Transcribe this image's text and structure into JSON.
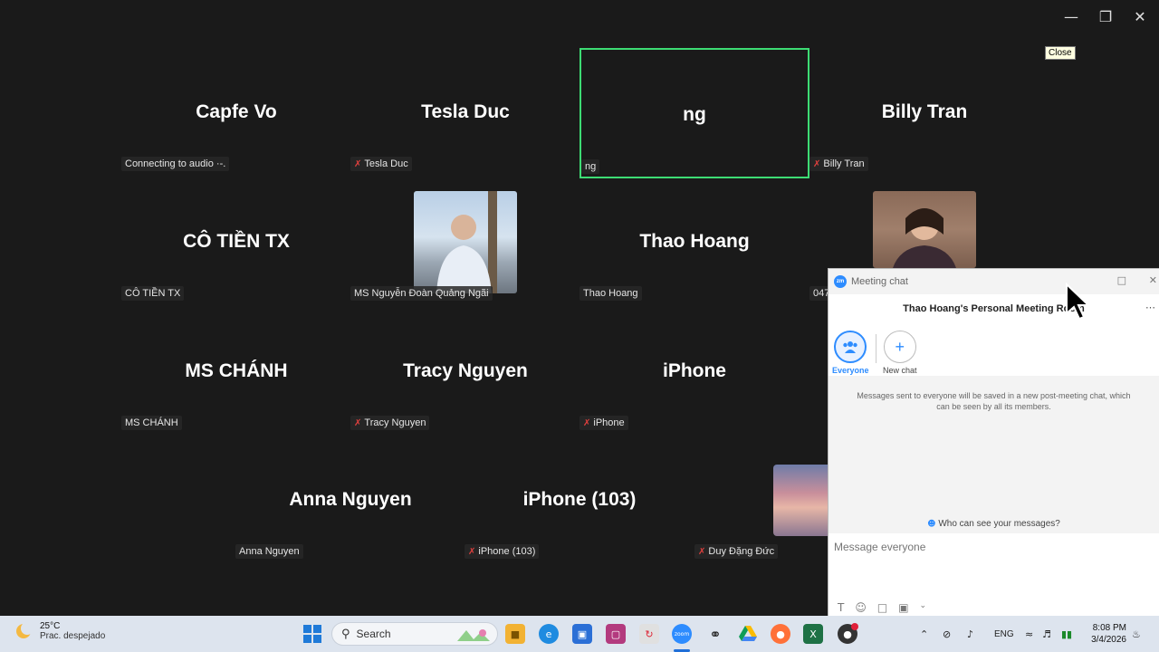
{
  "tooltip": "Close",
  "tiles": [
    {
      "name": "Capfe Vo",
      "label": "Connecting to audio ·-.",
      "muted": false
    },
    {
      "name": "Tesla Duc",
      "label": "Tesla Duc",
      "muted": true
    },
    {
      "name": "ng",
      "label": "ng",
      "muted": false
    },
    {
      "name": "Billy Tran",
      "label": "Billy Tran",
      "muted": true
    },
    {
      "name": "CÔ TIỀN TX",
      "label": "CÔ TIỀN TX",
      "muted": false
    },
    {
      "name": "",
      "label": "MS Nguyễn Đoàn Quảng Ngãi",
      "muted": false
    },
    {
      "name": "Thao Hoang",
      "label": "Thao Hoang",
      "muted": false
    },
    {
      "name": "",
      "label": "047",
      "muted": false
    },
    {
      "name": "MS CHÁNH",
      "label": "MS CHÁNH",
      "muted": false
    },
    {
      "name": "Tracy Nguyen",
      "label": "Tracy Nguyen",
      "muted": true
    },
    {
      "name": "iPhone",
      "label": "iPhone",
      "muted": true
    },
    {
      "name": "Anna Nguyen",
      "label": "Anna Nguyen",
      "muted": false
    },
    {
      "name": "iPhone (103)",
      "label": "iPhone (103)",
      "muted": true
    },
    {
      "name": "",
      "label": "Duy Đặng Đức",
      "muted": true
    }
  ],
  "chat": {
    "window_title": "Meeting chat",
    "logo_text": "zm",
    "room_title": "Thao Hoang's Personal Meeting Room",
    "everyone_label": "Everyone",
    "new_chat_label": "New chat",
    "info_text": "Messages sent to everyone will be saved in a new post-meeting chat, which can be seen by all its members.",
    "who_can_see": "Who can see your messages?",
    "placeholder": "Message everyone"
  },
  "taskbar": {
    "temperature": "25°C",
    "weather_desc": "Prac. despejado",
    "search_label": "Search",
    "language": "ENG",
    "time": "8:08 PM",
    "date": "3/4/2026"
  },
  "colors": {
    "active_border": "#3ddc74",
    "zoom_blue": "#2d8cff",
    "muted_red": "#e0403e"
  }
}
